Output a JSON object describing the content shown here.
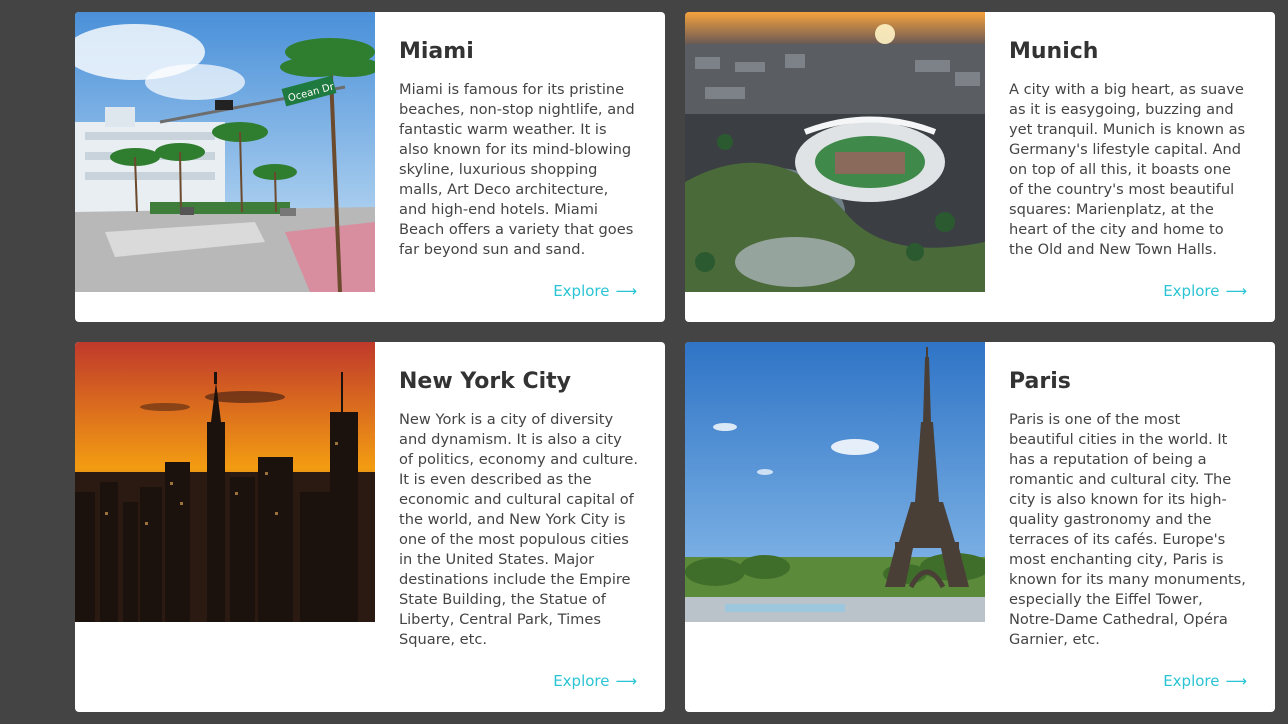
{
  "cards": [
    {
      "title": "Miami",
      "description": "Miami is famous for its pristine beaches, non-stop nightlife, and fantastic warm weather. It is also known for its mind-blowing skyline, luxurious shopping malls, Art Deco architecture, and high-end hotels. Miami Beach offers a variety that goes far beyond sun and sand.",
      "link": "Explore",
      "image": "miami-street-photo",
      "street_sign": "Ocean Dr"
    },
    {
      "title": "Munich",
      "description": "A city with a big heart, as suave as it is easygoing, buzzing and yet tranquil. Munich is known as Germany's lifestyle capital. And on top of all this, it boasts one of the country's most beautiful squares: Marienplatz, at the heart of the city and home to the Old and New Town Halls.",
      "link": "Explore",
      "image": "munich-olympic-park-aerial-photo"
    },
    {
      "title": "New York City",
      "description": "New York is a city of diversity and dynamism. It is also a city of politics, economy and culture. It is even described as the economic and cultural capital of the world, and New York City is one of the most populous cities in the United States. Major destinations include the Empire State Building, the Statue of Liberty, Central Park, Times Square, etc.",
      "link": "Explore",
      "image": "new-york-skyline-sunset-photo"
    },
    {
      "title": "Paris",
      "description": "Paris is one of the most beautiful cities in the world. It has a reputation of being a romantic and cultural city. The city is also known for its high-quality gastronomy and the terraces of its cafés. Europe's most enchanting city, Paris is known for its many monuments, especially the Eiffel Tower, Notre-Dame Cathedral, Opéra Garnier, etc.",
      "link": "Explore",
      "image": "eiffel-tower-photo"
    }
  ],
  "link_arrow": "⟶",
  "colors": {
    "background": "#444444",
    "card": "#ffffff",
    "accent": "#2bc4d4",
    "title": "#333333"
  }
}
